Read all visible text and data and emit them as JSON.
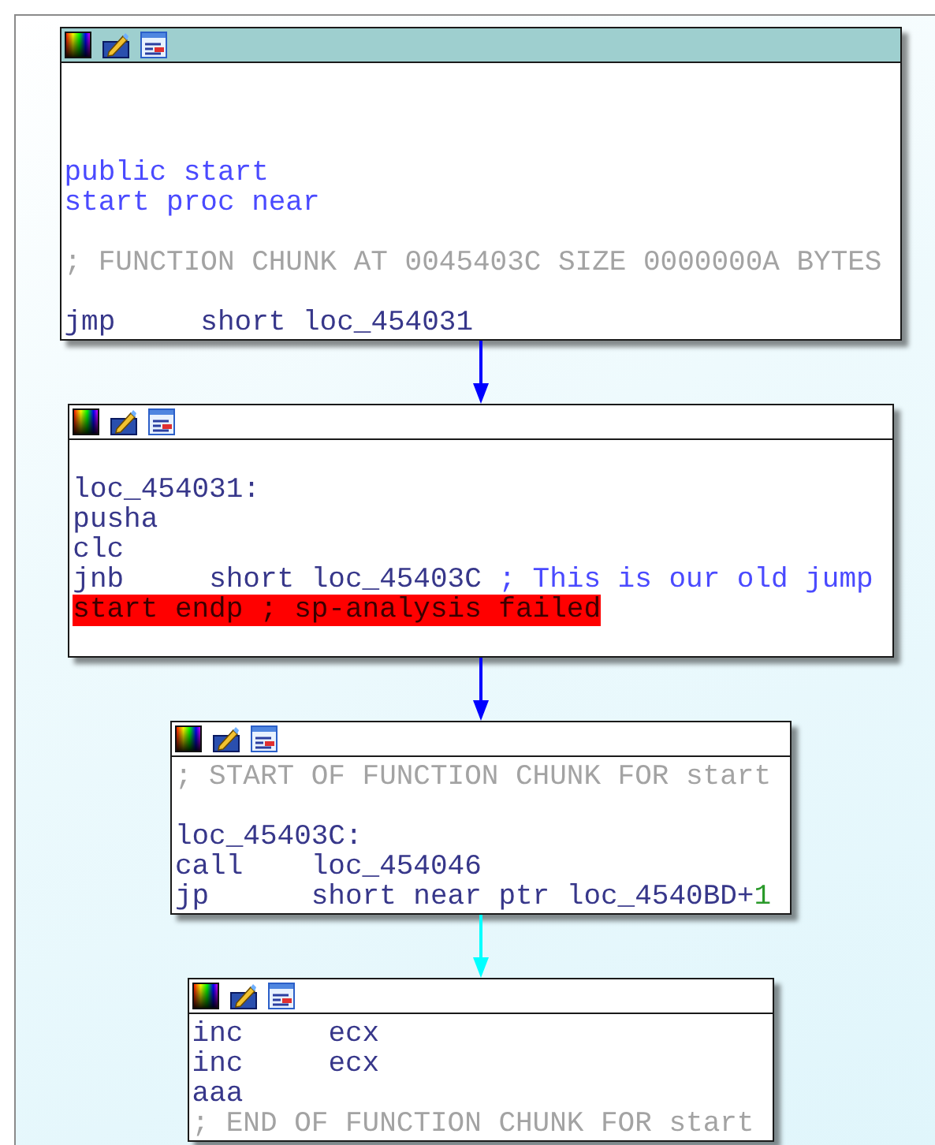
{
  "graph": {
    "nodes": [
      {
        "selected": true,
        "lines": [
          {
            "kind": "blank"
          },
          {
            "kind": "blank"
          },
          {
            "kind": "blank"
          },
          {
            "kind": "directive",
            "text": "public start"
          },
          {
            "kind": "directive",
            "text": "start proc near"
          },
          {
            "kind": "blank"
          },
          {
            "kind": "comment",
            "text": "; FUNCTION CHUNK AT 0045403C SIZE 0000000A BYTES"
          },
          {
            "kind": "blank"
          },
          {
            "kind": "insn",
            "mnemonic": "jmp",
            "operand": "short loc_454031"
          }
        ]
      },
      {
        "selected": false,
        "lines": [
          {
            "kind": "blank"
          },
          {
            "kind": "label",
            "text": "loc_454031:"
          },
          {
            "kind": "insn",
            "mnemonic": "pusha"
          },
          {
            "kind": "insn",
            "mnemonic": "clc"
          },
          {
            "kind": "insn",
            "mnemonic": "jnb",
            "operand": "short loc_45403C",
            "comment": "; This is our old jump"
          },
          {
            "kind": "error",
            "text": "start endp ; sp-analysis failed"
          },
          {
            "kind": "blank"
          }
        ]
      },
      {
        "selected": false,
        "lines": [
          {
            "kind": "comment",
            "text": "; START OF FUNCTION CHUNK FOR start"
          },
          {
            "kind": "blank"
          },
          {
            "kind": "label",
            "text": "loc_45403C:"
          },
          {
            "kind": "insn",
            "mnemonic": "call",
            "operand": "loc_454046"
          },
          {
            "kind": "insn",
            "mnemonic": "jp",
            "operand": "short near ptr loc_4540BD+",
            "number": "1"
          }
        ]
      },
      {
        "selected": false,
        "lines": [
          {
            "kind": "insn",
            "mnemonic": "inc",
            "operand": "ecx"
          },
          {
            "kind": "insn",
            "mnemonic": "inc",
            "operand": "ecx"
          },
          {
            "kind": "insn",
            "mnemonic": "aaa"
          },
          {
            "kind": "comment",
            "text": "; END OF FUNCTION CHUNK FOR start"
          }
        ]
      }
    ],
    "edges": [
      {
        "color": "#0000ff"
      },
      {
        "color": "#0000ff"
      },
      {
        "color": "#00ffff"
      }
    ]
  }
}
